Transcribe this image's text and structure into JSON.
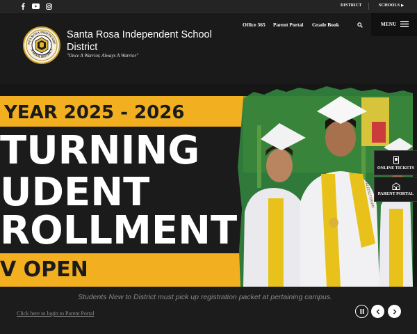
{
  "topbar": {
    "social_icons": [
      "facebook-icon",
      "youtube-icon",
      "instagram-icon"
    ],
    "district_label": "DISTRICT",
    "schools_label": "SCHOOLS"
  },
  "header": {
    "school_name": "Santa Rosa Independent School District",
    "motto": "\"Once A Warrior, Always A Warrior\"",
    "logo_text": [
      "SANTA ROSA INDEPENDENT",
      "SCHOOL DISTRICT"
    ],
    "nav": [
      "Office 365",
      "Parent Portal",
      "Grade Book"
    ],
    "search_icon": "search-icon",
    "menu_label": "MENU"
  },
  "hero": {
    "banner_year": "YEAR 2025 - 2026",
    "banner_lines": [
      "TURNING",
      "UDENT",
      "ROLLMENT"
    ],
    "banner_bottom": "V OPEN",
    "sash_text": "VALEDICTORIAN"
  },
  "quick_links": [
    {
      "label": "ONLINE TICKETS",
      "icon": "phone-ticket-icon"
    },
    {
      "label": "PARENT PORTAL",
      "icon": "school-building-icon"
    }
  ],
  "caption": "Students New to District must pick up registration packet at pertaining campus.",
  "portal_link": "Click here to login to Parent Portal",
  "colors": {
    "banner_yellow": "#f2b021",
    "banner_black": "#1b1b1b",
    "gown_white": "#e9e9ee",
    "sash_gold": "#e8c21a",
    "background": "#1c1c1c"
  }
}
